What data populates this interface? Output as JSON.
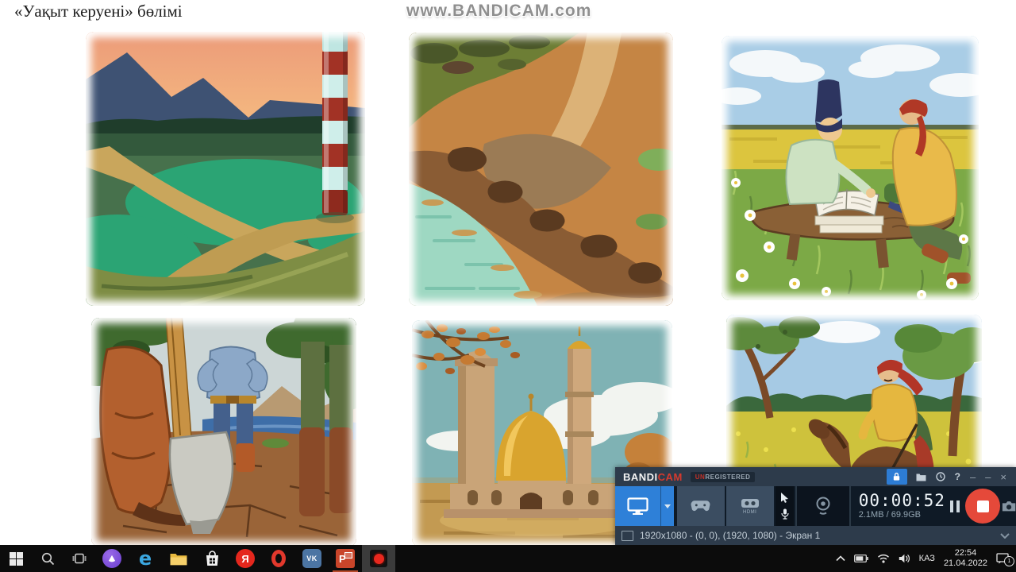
{
  "header": {
    "title": "«Уақыт керуені» бөлімі",
    "watermark": "www.BANDICAM.com"
  },
  "bandicam": {
    "logo_bandi": "BANDI",
    "logo_cam": "CAM",
    "unreg_red": "UN",
    "unreg_rest": "REGISTERED",
    "help": "?",
    "controls": {
      "minimize": "–",
      "minimize_alt": "–",
      "close": "×"
    },
    "hdmi_label": "HDMI",
    "timer": "00:00:52",
    "size_info": "2.1MB / 69.9GB",
    "region_info": "1920x1080 - (0, 0), (1920, 1080) - Экран 1"
  },
  "taskbar": {
    "edge_letter": "e",
    "yandex_letter": "Я",
    "vk_label": "VK",
    "ppt_letter": "P",
    "language": "КАЗ",
    "time": "22:54",
    "date": "21.04.2022",
    "notification_count": "1"
  },
  "colors": {
    "accent_blue": "#2E80D8",
    "record_red": "#E5493A",
    "logo_red": "#D63A2E",
    "taskbar_black": "#0C0C0C"
  }
}
